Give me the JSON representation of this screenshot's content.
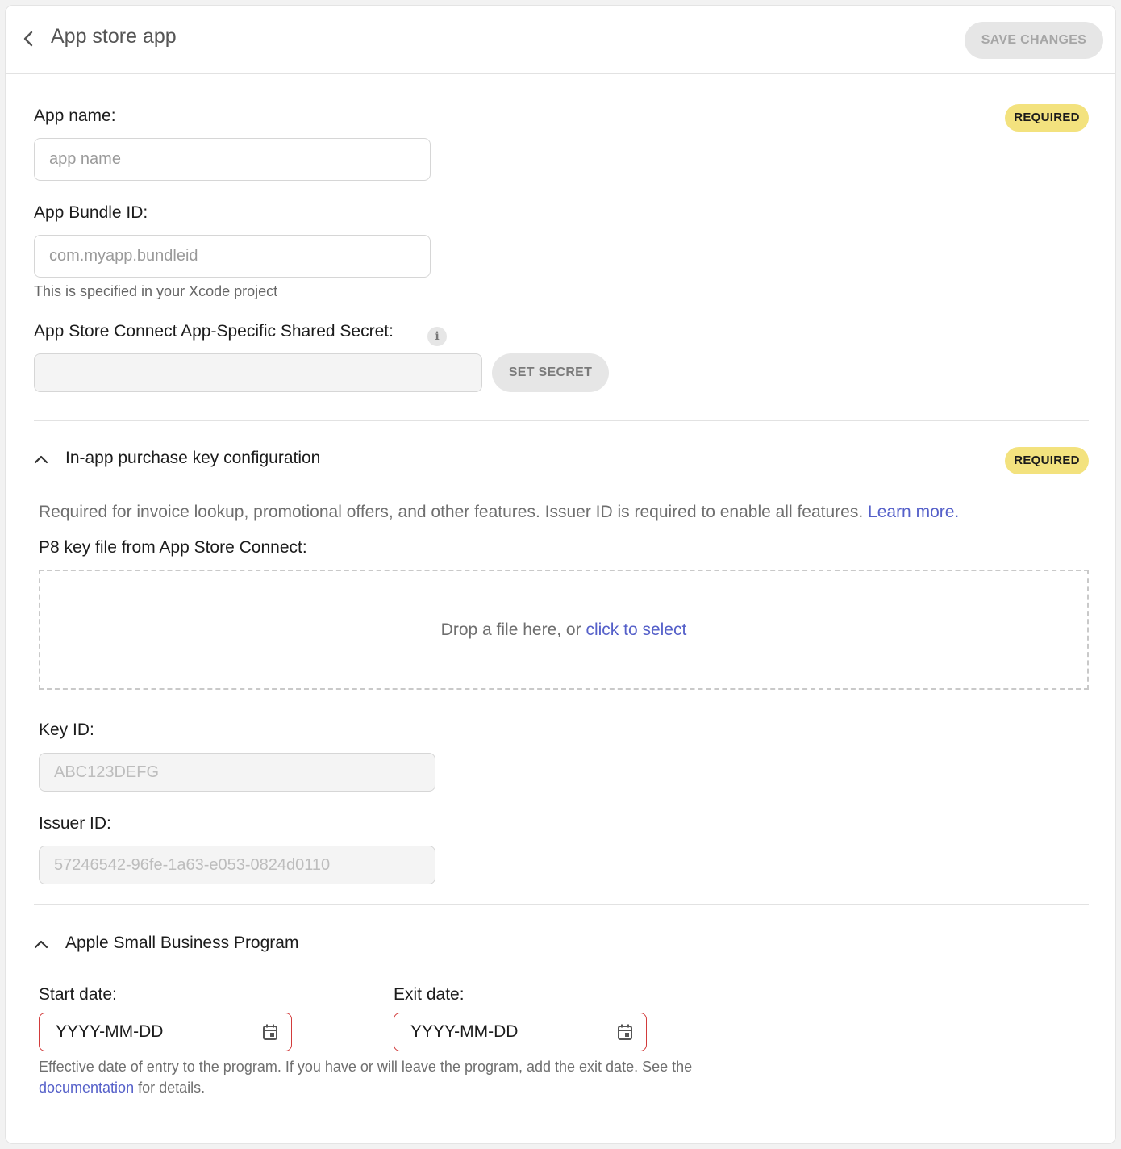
{
  "header": {
    "title": "App store app",
    "save_label": "SAVE CHANGES"
  },
  "general": {
    "required_badge": "REQUIRED",
    "app_name_label": "App name:",
    "app_name_placeholder": "app name",
    "bundle_label": "App Bundle ID:",
    "bundle_placeholder": "com.myapp.bundleid",
    "bundle_hint": "This is specified in your Xcode project",
    "secret_label": "App Store Connect App-Specific Shared Secret:",
    "info_icon": "i",
    "secret_value": "",
    "set_secret_label": "SET SECRET"
  },
  "iap": {
    "title": "In-app purchase key configuration",
    "required_badge": "REQUIRED",
    "description": "Required for invoice lookup, promotional offers, and other features. Issuer ID is required to enable all features.",
    "learn_more": "Learn more.",
    "p8_label": "P8 key file from App Store Connect:",
    "drop_text": "Drop a file here, or",
    "drop_link": "click to select",
    "key_id_label": "Key ID:",
    "key_id_placeholder": "ABC123DEFG",
    "issuer_id_label": "Issuer ID:",
    "issuer_id_placeholder": "57246542-96fe-1a63-e053-0824d0110"
  },
  "sbp": {
    "title": "Apple Small Business Program",
    "start_label": "Start date:",
    "start_value": "YYYY-MM-DD",
    "exit_label": "Exit date:",
    "exit_value": "YYYY-MM-DD",
    "footnote_text": "Effective date of entry to the program. If you have or will leave the program, add the exit date. See the",
    "footnote_link": "documentation",
    "footnote_tail": "for details."
  },
  "colors": {
    "badge": "#f3e27e",
    "link": "#5560c9",
    "error_border": "#d23b3b"
  },
  "icons": [
    "chevron-left-icon",
    "info-icon",
    "chevron-up-icon",
    "calendar-icon"
  ]
}
